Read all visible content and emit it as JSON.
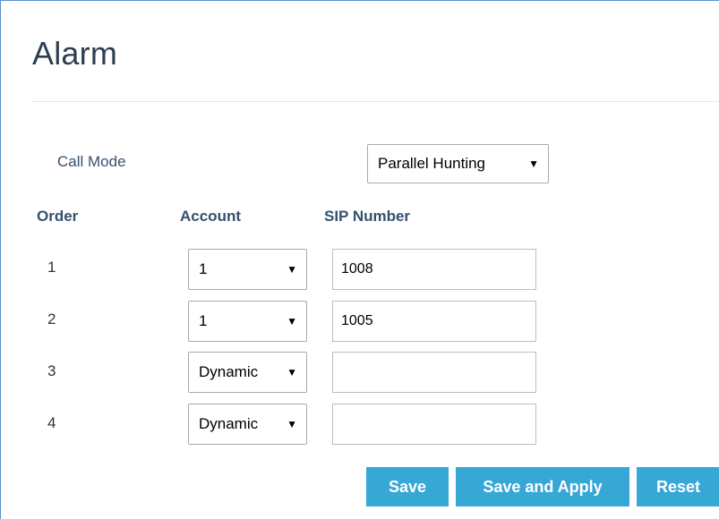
{
  "page": {
    "title": "Alarm"
  },
  "call_mode": {
    "label": "Call Mode",
    "selected": "Parallel Hunting"
  },
  "table": {
    "headers": {
      "order": "Order",
      "account": "Account",
      "sip_number": "SIP Number"
    },
    "rows": [
      {
        "order": "1",
        "account": "1",
        "sip_number": "1008"
      },
      {
        "order": "2",
        "account": "1",
        "sip_number": "1005"
      },
      {
        "order": "3",
        "account": "Dynamic",
        "sip_number": ""
      },
      {
        "order": "4",
        "account": "Dynamic",
        "sip_number": ""
      }
    ]
  },
  "buttons": {
    "save": "Save",
    "save_and_apply": "Save and Apply",
    "reset": "Reset"
  },
  "icons": {
    "dropdown_arrow": "▼"
  },
  "colors": {
    "title": "#2d3e50",
    "label": "#35506f",
    "button_bg": "#37a7d6",
    "button_text": "#ffffff",
    "frame_border": "#5b8fc9"
  }
}
